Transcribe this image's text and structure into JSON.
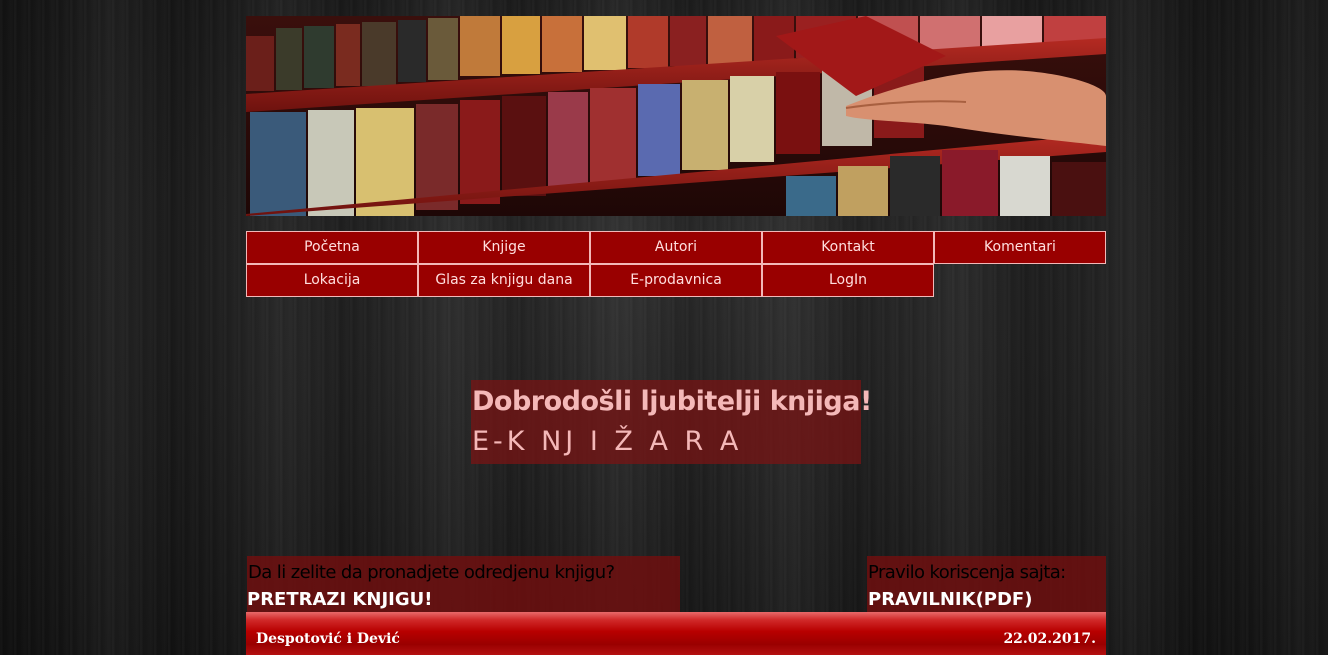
{
  "banner": {
    "image_subject": "books-on-shelf"
  },
  "nav": {
    "row1": [
      {
        "label": "Početna"
      },
      {
        "label": "Knjige"
      },
      {
        "label": "Autori"
      },
      {
        "label": "Kontakt"
      },
      {
        "label": "Komentari"
      }
    ],
    "row2": [
      {
        "label": "Lokacija"
      },
      {
        "label": "Glas za knjigu dana"
      },
      {
        "label": "E-prodavnica"
      },
      {
        "label": "LogIn"
      }
    ]
  },
  "welcome": {
    "title": "Dobrodošli ljubitelji knjiga!",
    "subtitle": "E-K NJ I Ž A R A"
  },
  "search": {
    "question": "Da li zelite da pronadjete odredjenu knjigu?",
    "link": "PRETRAZI KNJIGU!"
  },
  "rules": {
    "question": "Pravilo koriscenja sajta:",
    "link": "PRAVILNIK(PDF)"
  },
  "footer": {
    "authors": "Despotović i Dević",
    "date": "22.02.2017."
  },
  "colors": {
    "nav_bg": "#990000",
    "nav_border": "#f2b8b8",
    "accent_text": "#f4b8b8",
    "footer_red": "#b80000"
  }
}
